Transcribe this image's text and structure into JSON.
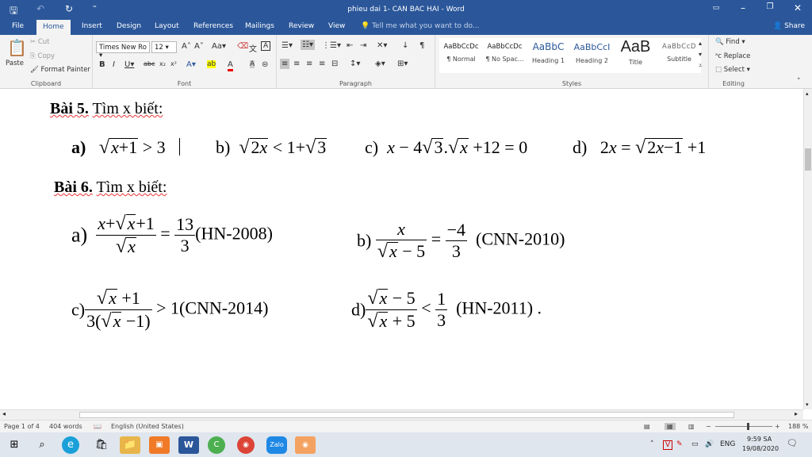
{
  "window": {
    "title": "phieu dai 1- CAN BAC HAI - Word",
    "qa_save": "🖫",
    "qa_undo": "↶",
    "qa_redo": "↻",
    "qa_more": "⁼"
  },
  "tabs": [
    "File",
    "Home",
    "Insert",
    "Design",
    "Layout",
    "References",
    "Mailings",
    "Review",
    "View"
  ],
  "tellme": "Tell me what you want to do...",
  "share": "Share",
  "ribbon": {
    "clipboard": {
      "label": "Clipboard",
      "paste": "Paste",
      "cut": "Cut",
      "copy": "Copy",
      "format_painter": "Format Painter"
    },
    "font": {
      "label": "Font",
      "family": "Times New Ro",
      "size": "12"
    },
    "paragraph": {
      "label": "Paragraph"
    },
    "styles": {
      "label": "Styles",
      "items": [
        {
          "sample": "AaBbCcDc",
          "name": "¶ Normal"
        },
        {
          "sample": "AaBbCcDc",
          "name": "¶ No Spac..."
        },
        {
          "sample": "AaBbC",
          "name": "Heading 1"
        },
        {
          "sample": "AaBbCcI",
          "name": "Heading 2"
        },
        {
          "sample": "AaB",
          "name": "Title"
        },
        {
          "sample": "AaBbCcD",
          "name": "Subtitle"
        }
      ]
    },
    "editing": {
      "label": "Editing",
      "find": "Find",
      "replace": "Replace",
      "select": "Select"
    }
  },
  "doc": {
    "bai5": {
      "title": "Bài 5.",
      "desc": "Tìm x biết:"
    },
    "bai6": {
      "title": "Bài 6.",
      "desc": "Tìm x biết:"
    },
    "refs": {
      "a": "(HN-2008)",
      "b": "(CNN-2010)",
      "c": "(CNN-2014)",
      "d": "(HN-2011) ."
    }
  },
  "status": {
    "page": "Page 1 of 4",
    "words": "404 words",
    "lang": "English (United States)",
    "zoom": "188 %"
  },
  "tray": {
    "lang": "ENG",
    "time": "9:59 SA",
    "date": "19/08/2020"
  },
  "colors": {
    "word_blue": "#2b579a",
    "taskbar": "#dfe6ee"
  }
}
